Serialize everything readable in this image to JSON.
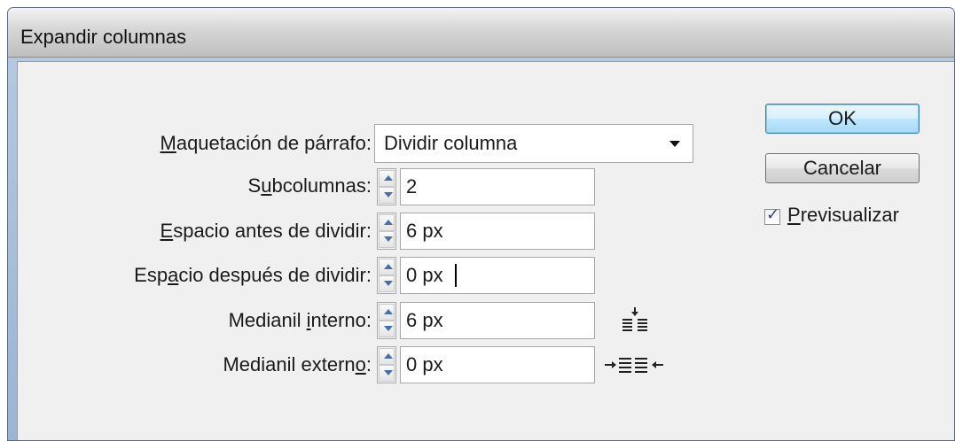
{
  "window": {
    "title": "Expandir columnas"
  },
  "form": {
    "paragraph_layout": {
      "label_pre": "",
      "label_key": "M",
      "label_post": "aquetación de párrafo:",
      "value": "Dividir columna"
    },
    "subcolumns": {
      "label_pre": "S",
      "label_key": "u",
      "label_post": "bcolumnas:",
      "value": "2"
    },
    "space_before": {
      "label_pre": "",
      "label_key": "E",
      "label_post": "spacio antes de dividir:",
      "value": "6 px"
    },
    "space_after": {
      "label_pre": "Esp",
      "label_key": "a",
      "label_post": "cio después de dividir:",
      "value": "0 px"
    },
    "inside_gutter": {
      "label_pre": "Medianil ",
      "label_key": "i",
      "label_post": "nterno:",
      "value": "6 px"
    },
    "outside_gutter": {
      "label_pre": "Medianil extern",
      "label_key": "o",
      "label_post": ":",
      "value": "0 px"
    }
  },
  "buttons": {
    "ok": "OK",
    "cancel": "Cancelar"
  },
  "preview": {
    "label_pre": "",
    "label_key": "P",
    "label_post": "revisualizar",
    "checked": true
  },
  "icons": {
    "inside_gutter": "inside-gutter-icon",
    "outside_gutter": "outside-gutter-icon",
    "spinner_up": "spinner-up-icon",
    "spinner_down": "spinner-down-icon",
    "dropdown": "chevron-down-icon"
  }
}
